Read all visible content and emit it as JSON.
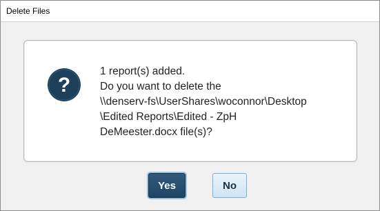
{
  "window": {
    "title": "Delete Files"
  },
  "message": {
    "icon": "question-icon",
    "lines": [
      "1 report(s) added.",
      "Do you want to delete the",
      "\\\\denserv-fs\\UserShares\\woconnor\\Desktop",
      "\\Edited Reports\\Edited - ZpH",
      "DeMeester.docx file(s)?"
    ]
  },
  "buttons": {
    "yes_label": "Yes",
    "no_label": "No"
  },
  "colors": {
    "icon_fill": "#1e3f5a",
    "yes_button": "#264d6e",
    "no_button": "#dcebf7"
  }
}
